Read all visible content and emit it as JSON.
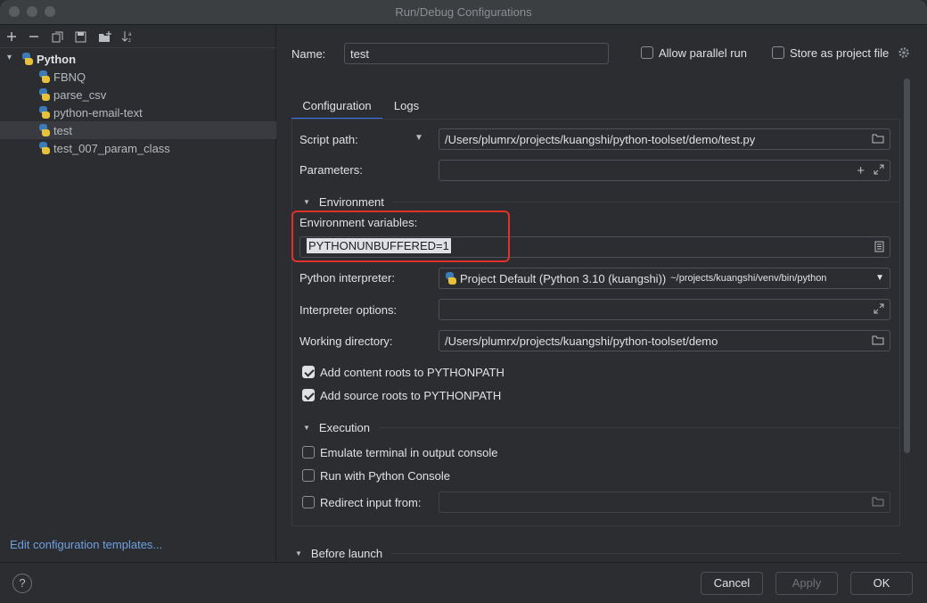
{
  "window": {
    "title": "Run/Debug Configurations"
  },
  "toolbar": {
    "icons": [
      "plus-icon",
      "minus-icon",
      "copy-icon",
      "save-icon",
      "new-folder-icon",
      "sort-icon"
    ]
  },
  "tree": {
    "root": {
      "label": "Python",
      "expanded": true
    },
    "items": [
      {
        "label": "FBNQ",
        "selected": false
      },
      {
        "label": "parse_csv",
        "selected": false
      },
      {
        "label": "python-email-text",
        "selected": false
      },
      {
        "label": "test",
        "selected": true
      },
      {
        "label": "test_007_param_class",
        "selected": false
      }
    ]
  },
  "left_footer": {
    "edit_templates": "Edit configuration templates..."
  },
  "header": {
    "name_label": "Name:",
    "name_value": "test",
    "allow_parallel_label": "Allow parallel run",
    "allow_parallel_checked": false,
    "store_project_label": "Store as project file",
    "store_project_checked": false
  },
  "tabs": [
    {
      "label": "Configuration",
      "active": true
    },
    {
      "label": "Logs",
      "active": false
    }
  ],
  "config": {
    "script_path_label": "Script path:",
    "script_path_value": "/Users/plumrx/projects/kuangshi/python-toolset/demo/test.py",
    "parameters_label": "Parameters:",
    "parameters_value": "",
    "environment_section": "Environment",
    "env_vars_label": "Environment variables:",
    "env_vars_value": "PYTHONUNBUFFERED=1",
    "interpreter_label": "Python interpreter:",
    "interpreter_value": "Project Default (Python 3.10 (kuangshi))",
    "interpreter_path": "~/projects/kuangshi/venv/bin/python",
    "interp_options_label": "Interpreter options:",
    "interp_options_value": "",
    "working_dir_label": "Working directory:",
    "working_dir_value": "/Users/plumrx/projects/kuangshi/python-toolset/demo",
    "add_content_roots_label": "Add content roots to PYTHONPATH",
    "add_content_roots_checked": true,
    "add_source_roots_label": "Add source roots to PYTHONPATH",
    "add_source_roots_checked": true,
    "execution_section": "Execution",
    "emulate_terminal_label": "Emulate terminal in output console",
    "emulate_terminal_checked": false,
    "python_console_label": "Run with Python Console",
    "python_console_checked": false,
    "redirect_input_label": "Redirect input from:",
    "redirect_input_checked": false,
    "redirect_input_value": "",
    "before_launch_section": "Before launch"
  },
  "footer": {
    "help_label": "?",
    "cancel_label": "Cancel",
    "apply_label": "Apply",
    "ok_label": "OK"
  },
  "colors": {
    "highlight": "#e0312a",
    "link": "#6ea0e0",
    "accent": "#3574f0"
  }
}
